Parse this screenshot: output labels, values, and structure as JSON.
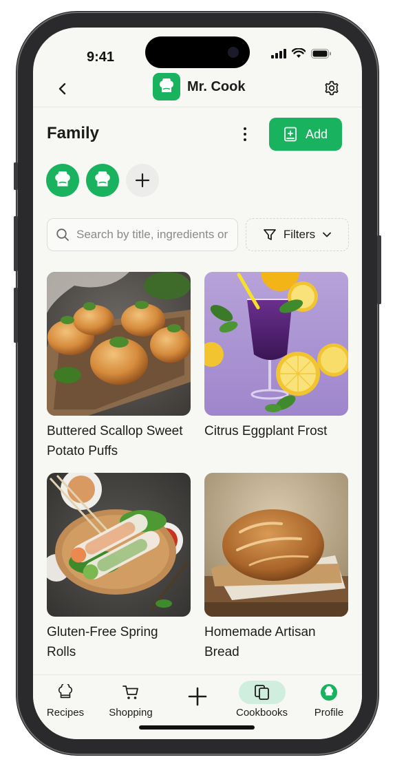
{
  "status_bar": {
    "time": "9:41"
  },
  "header": {
    "app_name": "Mr. Cook"
  },
  "cookbook": {
    "title": "Family",
    "add_label": "Add",
    "members": [
      "chef-avatar",
      "chef-avatar"
    ]
  },
  "search": {
    "placeholder": "Search by title, ingredients or tags",
    "value": ""
  },
  "filters": {
    "label": "Filters"
  },
  "recipes": [
    {
      "title": "Buttered Scallop Sweet Potato Puffs"
    },
    {
      "title": "Citrus Eggplant Frost"
    },
    {
      "title": "Gluten-Free Spring Rolls"
    },
    {
      "title": "Homemade Artisan Bread"
    }
  ],
  "bottom_nav": {
    "items": [
      {
        "label": "Recipes",
        "icon": "chef-hat-icon"
      },
      {
        "label": "Shopping",
        "icon": "cart-icon"
      },
      {
        "label": "",
        "icon": "plus-icon"
      },
      {
        "label": "Cookbooks",
        "icon": "cookbooks-icon",
        "active": true
      },
      {
        "label": "Profile",
        "icon": "profile-avatar-icon"
      }
    ]
  },
  "colors": {
    "accent": "#19b35f",
    "accent_light": "#cfeedd",
    "background": "#f7f7f4"
  }
}
